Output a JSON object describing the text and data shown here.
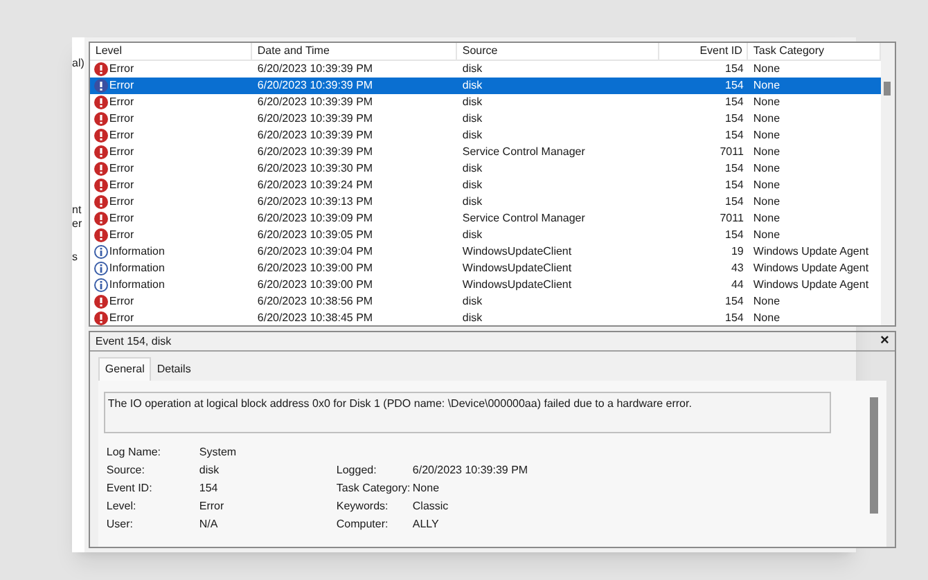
{
  "sidebar": {
    "fragments": [
      "al)",
      "nt",
      "er",
      "s"
    ]
  },
  "table": {
    "columns": [
      "Level",
      "Date and Time",
      "Source",
      "Event ID",
      "Task Category"
    ],
    "rows": [
      {
        "kind": "error",
        "level": "Error",
        "date": "6/20/2023 10:39:39 PM",
        "source": "disk",
        "event_id": "154",
        "category": "None",
        "selected": false
      },
      {
        "kind": "error",
        "level": "Error",
        "date": "6/20/2023 10:39:39 PM",
        "source": "disk",
        "event_id": "154",
        "category": "None",
        "selected": true
      },
      {
        "kind": "error",
        "level": "Error",
        "date": "6/20/2023 10:39:39 PM",
        "source": "disk",
        "event_id": "154",
        "category": "None",
        "selected": false
      },
      {
        "kind": "error",
        "level": "Error",
        "date": "6/20/2023 10:39:39 PM",
        "source": "disk",
        "event_id": "154",
        "category": "None",
        "selected": false
      },
      {
        "kind": "error",
        "level": "Error",
        "date": "6/20/2023 10:39:39 PM",
        "source": "disk",
        "event_id": "154",
        "category": "None",
        "selected": false
      },
      {
        "kind": "error",
        "level": "Error",
        "date": "6/20/2023 10:39:39 PM",
        "source": "Service Control Manager",
        "event_id": "7011",
        "category": "None",
        "selected": false
      },
      {
        "kind": "error",
        "level": "Error",
        "date": "6/20/2023 10:39:30 PM",
        "source": "disk",
        "event_id": "154",
        "category": "None",
        "selected": false
      },
      {
        "kind": "error",
        "level": "Error",
        "date": "6/20/2023 10:39:24 PM",
        "source": "disk",
        "event_id": "154",
        "category": "None",
        "selected": false
      },
      {
        "kind": "error",
        "level": "Error",
        "date": "6/20/2023 10:39:13 PM",
        "source": "disk",
        "event_id": "154",
        "category": "None",
        "selected": false
      },
      {
        "kind": "error",
        "level": "Error",
        "date": "6/20/2023 10:39:09 PM",
        "source": "Service Control Manager",
        "event_id": "7011",
        "category": "None",
        "selected": false
      },
      {
        "kind": "error",
        "level": "Error",
        "date": "6/20/2023 10:39:05 PM",
        "source": "disk",
        "event_id": "154",
        "category": "None",
        "selected": false
      },
      {
        "kind": "information",
        "level": "Information",
        "date": "6/20/2023 10:39:04 PM",
        "source": "WindowsUpdateClient",
        "event_id": "19",
        "category": "Windows Update Agent",
        "selected": false
      },
      {
        "kind": "information",
        "level": "Information",
        "date": "6/20/2023 10:39:00 PM",
        "source": "WindowsUpdateClient",
        "event_id": "43",
        "category": "Windows Update Agent",
        "selected": false
      },
      {
        "kind": "information",
        "level": "Information",
        "date": "6/20/2023 10:39:00 PM",
        "source": "WindowsUpdateClient",
        "event_id": "44",
        "category": "Windows Update Agent",
        "selected": false
      },
      {
        "kind": "error",
        "level": "Error",
        "date": "6/20/2023 10:38:56 PM",
        "source": "disk",
        "event_id": "154",
        "category": "None",
        "selected": false
      },
      {
        "kind": "error",
        "level": "Error",
        "date": "6/20/2023 10:38:45 PM",
        "source": "disk",
        "event_id": "154",
        "category": "None",
        "selected": false
      }
    ]
  },
  "details": {
    "title": "Event 154, disk",
    "close": "×",
    "tabs": [
      {
        "label": "General",
        "selected": true
      },
      {
        "label": "Details",
        "selected": false
      }
    ],
    "message": "The IO operation at logical block address 0x0 for Disk 1 (PDO name: \\Device\\000000aa) failed due to a hardware error.",
    "fields": [
      [
        {
          "label": "Log Name:",
          "value": "System"
        }
      ],
      [
        {
          "label": "Source:",
          "value": "disk"
        },
        {
          "label": "Logged:",
          "value": "6/20/2023 10:39:39 PM"
        }
      ],
      [
        {
          "label": "Event ID:",
          "value": "154"
        },
        {
          "label": "Task Category:",
          "value": "None"
        }
      ],
      [
        {
          "label": "Level:",
          "value": "Error"
        },
        {
          "label": "Keywords:",
          "value": "Classic"
        }
      ],
      [
        {
          "label": "User:",
          "value": "N/A"
        },
        {
          "label": "Computer:",
          "value": "ALLY"
        }
      ]
    ]
  }
}
